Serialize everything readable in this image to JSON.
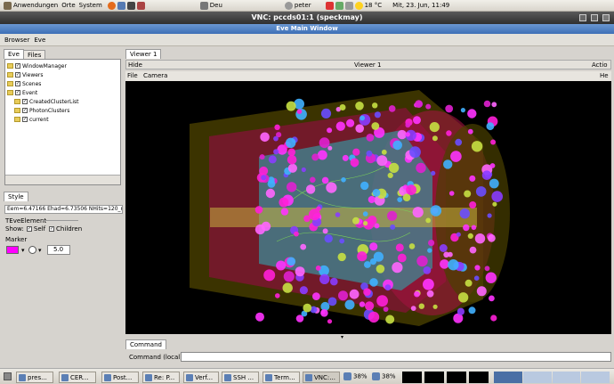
{
  "top_panel": {
    "applications": "Anwendungen",
    "places": "Orte",
    "system": "System",
    "keyboard": "Deu",
    "user": "peter",
    "weather": "18 °C",
    "clock": "Mit, 23. Jun, 11:49"
  },
  "vnc_title": "VNC: pccds01:1 (speckmay)",
  "eve_title": "Eve Main Window",
  "menu": [
    "Browser",
    "Eve"
  ],
  "left_tabs": [
    "Eve",
    "Files"
  ],
  "tree": [
    "WindowManager",
    "Viewers",
    "Scenes",
    "Event",
    "CreatedClusterList",
    "PhotonClusters",
    "current"
  ],
  "style_tab": "Style",
  "selected_label": "Eem=6.47166 Ehad=6.73506 NHits=120_m",
  "element_class": "TEveElement",
  "show": {
    "label": "Show:",
    "self": "Self",
    "children": "Children"
  },
  "marker": {
    "label": "Marker",
    "size": "5.0"
  },
  "viewer_tab": "Viewer 1",
  "viewer_header": {
    "hide": "Hide",
    "title": "Viewer 1",
    "action": "Actio"
  },
  "viewer_menu": {
    "file": "File",
    "camera": "Camera",
    "help": "He"
  },
  "command": {
    "tab": "Command",
    "label": "Command (local):"
  },
  "taskbar": [
    "pres...",
    "CER...",
    "Post...",
    "Re: P...",
    "Verf...",
    "SSH ...",
    "Term...",
    "VNC:..."
  ],
  "cpu": [
    "38%",
    "38%"
  ],
  "colors": {
    "accent": "#3d6fb6",
    "magenta": "#ff00ff"
  }
}
